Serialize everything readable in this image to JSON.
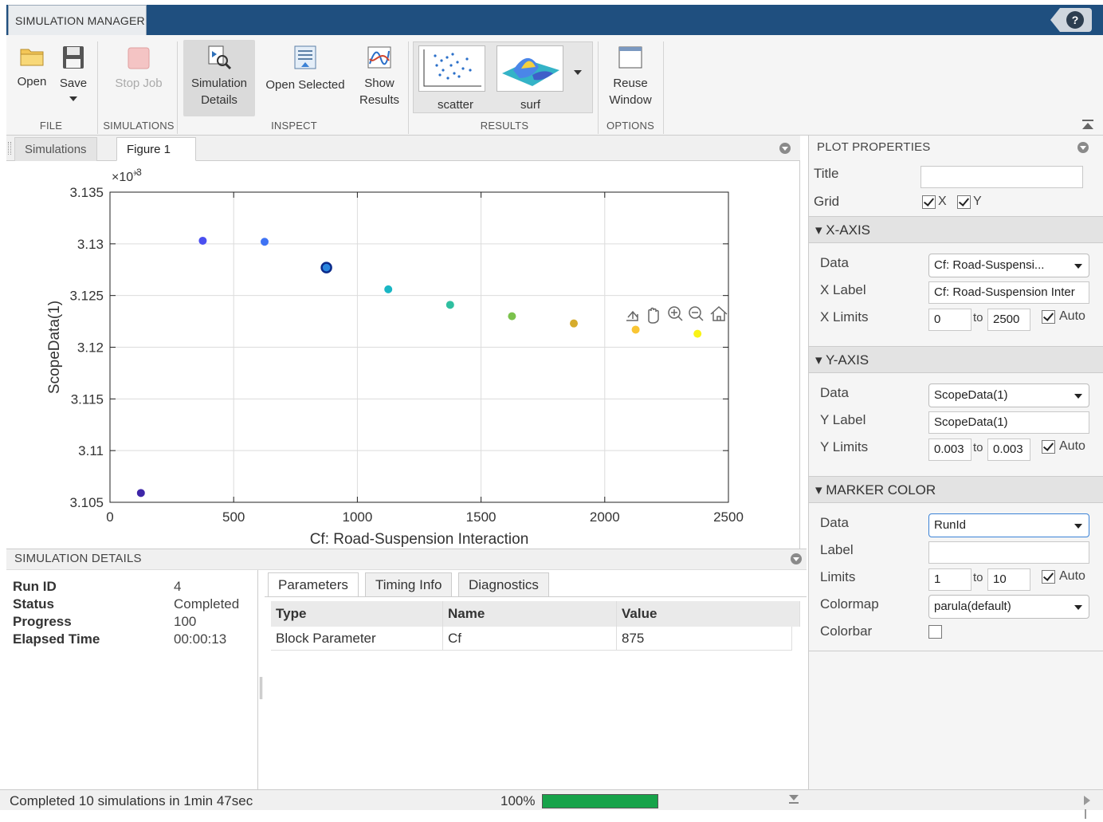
{
  "app": {
    "tab_title": "SIMULATION MANAGER",
    "help": "?"
  },
  "ribbon": {
    "open": "Open",
    "save": "Save",
    "stop_job": "Stop Job",
    "sim_details_l1": "Simulation",
    "sim_details_l2": "Details",
    "open_selected": "Open Selected",
    "show_results_l1": "Show",
    "show_results_l2": "Results",
    "gallery_scatter": "scatter",
    "gallery_surf": "surf",
    "reuse_l1": "Reuse",
    "reuse_l2": "Window",
    "groups": {
      "file": "FILE",
      "simulations": "SIMULATIONS",
      "inspect": "INSPECT",
      "results": "RESULTS",
      "options": "OPTIONS"
    }
  },
  "doc_tabs": {
    "simulations": "Simulations",
    "figure": "Figure 1",
    "close": "×"
  },
  "chart_data": {
    "type": "scatter",
    "x": [
      125,
      375,
      625,
      875,
      1125,
      1375,
      1625,
      1875,
      2125,
      2375
    ],
    "y": [
      3.1059,
      3.1303,
      3.1302,
      3.1277,
      3.1256,
      3.1241,
      3.123,
      3.1223,
      3.1217,
      3.1213
    ],
    "colors": [
      "#3e26a8",
      "#4a4ff0",
      "#3f73f4",
      "#2a85de",
      "#19b6c4",
      "#2fbfa0",
      "#7bc24c",
      "#d6ac2c",
      "#f9c533",
      "#f9f316"
    ],
    "selected_index": 3,
    "xlabel": "Cf: Road-Suspension Interaction",
    "ylabel": "ScopeData(1)",
    "y_exponent_label": "×10",
    "y_exponent": "-3",
    "xlim": [
      0,
      2500
    ],
    "ylim": [
      3.105,
      3.135
    ],
    "xticks": [
      "0",
      "500",
      "1000",
      "1500",
      "2000",
      "2500"
    ],
    "yticks": [
      "3.135",
      "3.13",
      "3.125",
      "3.12",
      "3.115",
      "3.11",
      "3.105"
    ],
    "grid": true
  },
  "details": {
    "header": "SIMULATION DETAILS",
    "fields": [
      {
        "key": "Run ID",
        "value": "4"
      },
      {
        "key": "Status",
        "value": "Completed"
      },
      {
        "key": "Progress",
        "value": "100"
      },
      {
        "key": "Elapsed Time",
        "value": "00:00:13"
      }
    ],
    "tabs": [
      "Parameters",
      "Timing Info",
      "Diagnostics"
    ],
    "table": {
      "columns": [
        "Type",
        "Name",
        "Value"
      ],
      "rows": [
        [
          "Block Parameter",
          "Cf",
          "875"
        ]
      ]
    }
  },
  "plot_properties": {
    "header": "PLOT PROPERTIES",
    "title_label": "Title",
    "title_value": "",
    "grid_label": "Grid",
    "grid_x": "X",
    "grid_y": "Y",
    "x_axis": {
      "header": "X-AXIS",
      "data_label": "Data",
      "data_value": "Cf: Road-Suspensi...",
      "label_label": "X Label",
      "label_value": "Cf: Road-Suspension Inter",
      "limits_label": "X Limits",
      "min": "0",
      "to": "to",
      "max": "2500",
      "auto": "Auto"
    },
    "y_axis": {
      "header": "Y-AXIS",
      "data_label": "Data",
      "data_value": "ScopeData(1)",
      "label_label": "Y Label",
      "label_value": "ScopeData(1)",
      "limits_label": "Y Limits",
      "min": "0.003",
      "to": "to",
      "max": "0.003",
      "auto": "Auto"
    },
    "marker_color": {
      "header": "MARKER COLOR",
      "data_label": "Data",
      "data_value": "RunId",
      "label_label": "Label",
      "label_value": "",
      "limits_label": "Limits",
      "min": "1",
      "to": "to",
      "max": "10",
      "auto": "Auto",
      "colormap_label": "Colormap",
      "colormap_value": "parula(default)",
      "colorbar_label": "Colorbar"
    }
  },
  "status": {
    "text": "Completed 10 simulations in 1min 47sec",
    "percent": "100%",
    "progress": 1.0
  }
}
